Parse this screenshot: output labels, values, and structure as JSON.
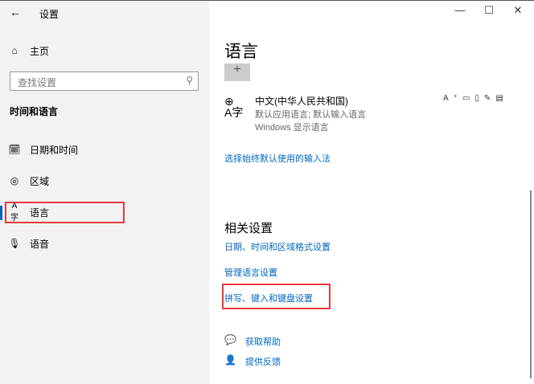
{
  "window": {
    "title": "设置",
    "back": "←",
    "minimize": "—",
    "maximize": "☐",
    "close": "✕"
  },
  "sidebar": {
    "home": "主页",
    "search_placeholder": "查找设置",
    "section": "时间和语言",
    "items": [
      {
        "label": "日期和时间"
      },
      {
        "label": "区域"
      },
      {
        "label": "语言"
      },
      {
        "label": "语音"
      }
    ]
  },
  "main": {
    "title": "语言",
    "add_symbol": "+",
    "language": {
      "name": "中文(中华人民共和国)",
      "line1": "默认应用语言; 默认输入语言",
      "line2": "Windows 显示语言"
    },
    "input_link": "选择始终默认使用的输入法",
    "related_title": "相关设置",
    "related_links": [
      "日期、时间和区域格式设置",
      "管理语言设置",
      "拼写、键入和键盘设置"
    ],
    "help": "获取帮助",
    "feedback": "提供反馈"
  },
  "colors": {
    "accent": "#0067c0",
    "highlight": "#e8383d"
  }
}
